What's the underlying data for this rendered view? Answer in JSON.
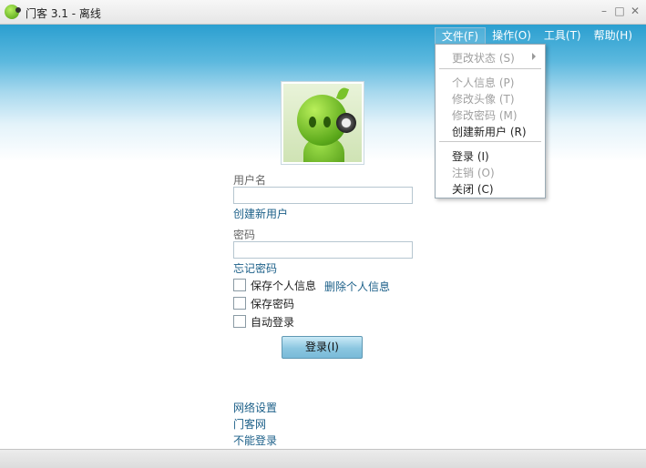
{
  "window": {
    "title": "门客 3.1 - 离线"
  },
  "menubar": {
    "items": [
      "文件(F)",
      "操作(O)",
      "工具(T)",
      "帮助(H)"
    ]
  },
  "file_menu": {
    "items": [
      {
        "label": "更改状态 (S)",
        "enabled": false,
        "submenu": true
      },
      {
        "label": "个人信息 (P)",
        "enabled": false
      },
      {
        "label": "修改头像 (T)",
        "enabled": false
      },
      {
        "label": "修改密码 (M)",
        "enabled": false
      },
      {
        "label": "创建新用户 (R)",
        "enabled": true
      },
      {
        "label": "登录 (I)",
        "enabled": true
      },
      {
        "label": "注销 (O)",
        "enabled": false
      },
      {
        "label": "关闭 (C)",
        "enabled": true
      }
    ]
  },
  "login": {
    "username_label": "用户名",
    "username_value": "",
    "create_user_link": "创建新用户",
    "password_label": "密码",
    "password_value": "",
    "forgot_password_link": "忘记密码",
    "save_profile_label": "保存个人信息",
    "delete_profile_link": "删除个人信息",
    "save_password_label": "保存密码",
    "auto_login_label": "自动登录",
    "login_button": "登录(I)"
  },
  "footer_links": [
    "网络设置",
    "门客网",
    "不能登录"
  ],
  "colors": {
    "accent": "#2b9fd0",
    "link": "#1b5f88"
  },
  "icons": {
    "app": "alien-logo-icon",
    "avatar": "alien-avatar-icon"
  }
}
